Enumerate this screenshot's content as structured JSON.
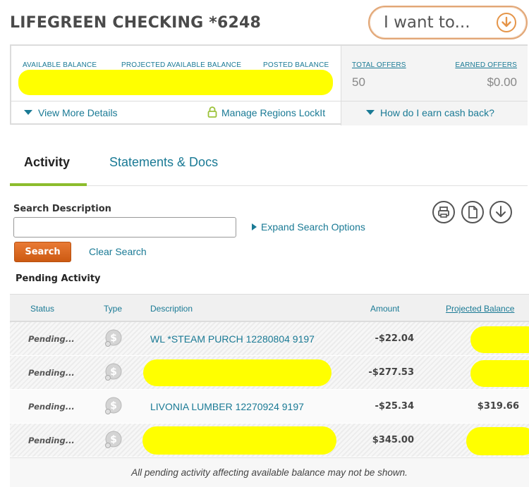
{
  "account": {
    "title": "LIFEGREEN CHECKING *6248",
    "iwant_label": "I want to..."
  },
  "summary": {
    "available_balance_label": "AVAILABLE BALANCE",
    "projected_available_balance_label": "PROJECTED AVAILABLE BALANCE",
    "posted_balance_label": "POSTED BALANCE",
    "total_offers_label": "TOTAL OFFERS",
    "total_offers_value": "50",
    "earned_offers_label": "EARNED OFFERS",
    "earned_offers_value": "$0.00",
    "view_more_details": "View More Details",
    "manage_lockit": "Manage Regions LockIt",
    "earn_cash_back": "How do I earn cash back?"
  },
  "tabs": [
    {
      "label": "Activity",
      "active": true
    },
    {
      "label": "Statements & Docs",
      "active": false
    }
  ],
  "search": {
    "label": "Search Description",
    "value": "",
    "expand_label": "Expand Search Options",
    "button_label": "Search",
    "clear_label": "Clear Search"
  },
  "toolbar_icons": [
    "print-icon",
    "document-icon",
    "download-icon"
  ],
  "pending": {
    "title": "Pending Activity",
    "columns": [
      "Status",
      "Type",
      "Description",
      "Amount",
      "Projected Balance"
    ],
    "rows": [
      {
        "status": "Pending...",
        "type_icon": "dollar-coin-icon",
        "description": "WL *STEAM PURCH 12280804 9197",
        "amount": "-$22.04",
        "projected_balance": ""
      },
      {
        "status": "Pending...",
        "type_icon": "dollar-coin-icon",
        "description": "",
        "amount": "-$277.53",
        "projected_balance": ""
      },
      {
        "status": "Pending...",
        "type_icon": "dollar-coin-icon",
        "description": "LIVONIA LUMBER 12270924 9197",
        "amount": "-$25.34",
        "projected_balance": "$319.66"
      },
      {
        "status": "Pending...",
        "type_icon": "dollar-coin-icon",
        "description": "",
        "amount": "$345.00",
        "projected_balance": ""
      }
    ],
    "footer_note": "All pending activity affecting available balance may not be shown."
  },
  "colors": {
    "accent_teal": "#1a7a95",
    "accent_orange": "#e0702a",
    "tab_underline_green": "#8cbc2c",
    "redaction_yellow": "#ffff00"
  }
}
